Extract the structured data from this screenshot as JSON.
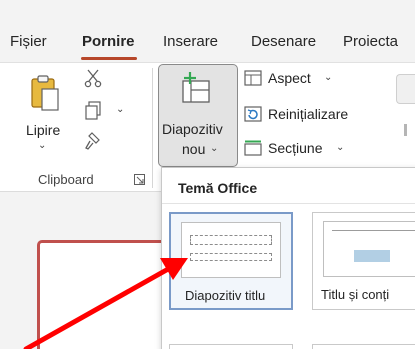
{
  "tabs": [
    "Fișier",
    "Pornire",
    "Inserare",
    "Desenare",
    "Proiecta"
  ],
  "ribbon": {
    "paste_label": "Lipire",
    "clipboard_group_label": "Clipboard",
    "new_slide_label_line1": "Diapozitiv",
    "new_slide_label_line2": "nou",
    "layout_label": "Aspect",
    "reset_label": "Reinițializare",
    "section_label": "Secțiune"
  },
  "dropdown": {
    "header": "Temă Office",
    "layouts": [
      {
        "label": "Diapozitiv titlu"
      },
      {
        "label": "Titlu și conți"
      }
    ]
  },
  "colors": {
    "accent_tab": "#b7472a",
    "arrow": "#ff0000",
    "selection_outline": "#7a9ac8",
    "slide_frame": "#c0504d"
  },
  "icons": [
    "paste-icon",
    "cut-icon",
    "copy-icon",
    "format-painter-icon",
    "new-slide-icon",
    "layout-icon",
    "reset-icon",
    "section-icon",
    "dialog-launcher-icon"
  ]
}
